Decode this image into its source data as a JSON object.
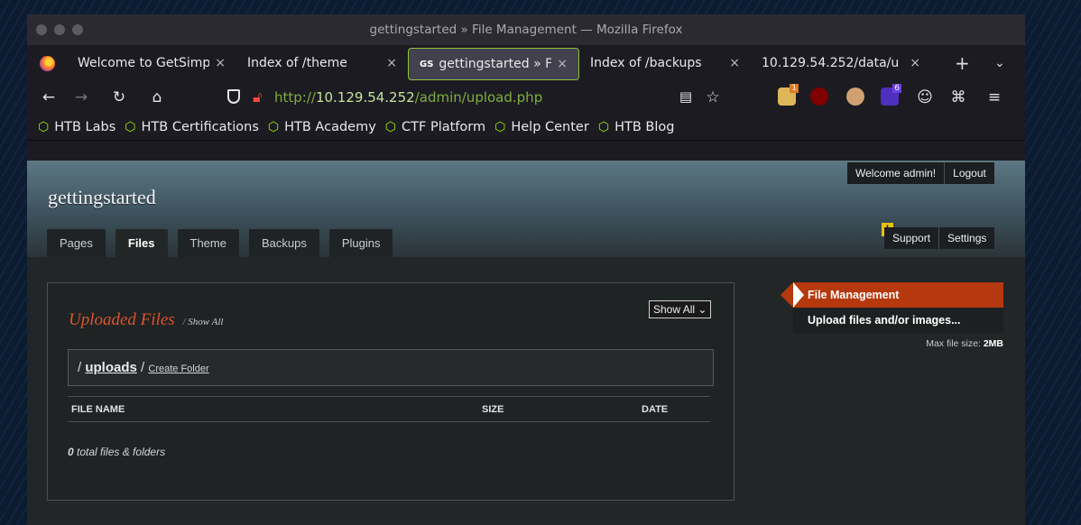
{
  "browser": {
    "window_title": "gettingstarted » File Management — Mozilla Firefox",
    "tabs": [
      {
        "label": "Welcome to GetSimp",
        "close": "×"
      },
      {
        "label": "Index of /theme",
        "close": "×"
      },
      {
        "label": "gettingstarted » F",
        "close": "×",
        "favicon_text": "GS",
        "active": true
      },
      {
        "label": "Index of /backups",
        "close": "×"
      },
      {
        "label": "10.129.54.252/data/u",
        "close": "×"
      }
    ],
    "new_tab": "+",
    "tab_list": "⌄",
    "url_scheme": "http://",
    "url_host": "10.129.54.252",
    "url_path": "/admin/upload.php",
    "ext_badges": [
      "1",
      "6"
    ],
    "bookmarks": [
      "HTB Labs",
      "HTB Certifications",
      "HTB Academy",
      "CTF Platform",
      "Help Center",
      "HTB Blog"
    ]
  },
  "site": {
    "title": "gettingstarted",
    "welcome": "Welcome admin!",
    "logout": "Logout",
    "warning": "!",
    "support": "Support",
    "settings": "Settings",
    "nav_tabs": [
      "Pages",
      "Files",
      "Theme",
      "Backups",
      "Plugins"
    ],
    "active_tab": "Files"
  },
  "files": {
    "heading": "Uploaded Files",
    "slash": "/",
    "show_all": "Show All",
    "filter_select": "Show All",
    "path_prefix": "/",
    "folder": "uploads",
    "path_sep": "/",
    "create_folder": "Create Folder",
    "columns": [
      "FILE NAME",
      "SIZE",
      "DATE"
    ],
    "total_count": "0",
    "total_label": "total files & folders"
  },
  "sidebar": {
    "active": "File Management",
    "upload": "Upload files and/or images...",
    "max_label": "Max file size:",
    "max_value": "2MB"
  },
  "colors": {
    "accent": "#b5380e",
    "title_orange": "#d9552d",
    "htb_green": "#9fef00"
  }
}
